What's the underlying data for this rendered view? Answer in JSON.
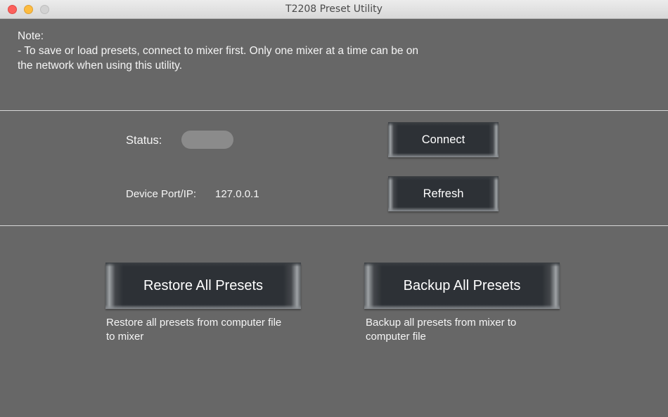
{
  "window": {
    "title": "T2208 Preset Utility"
  },
  "note": {
    "heading": "Note:",
    "line1": "- To save or load presets, connect to mixer first. Only one mixer at a time can be on",
    "line2": "the network when using this utility."
  },
  "connection": {
    "status_label": "Status:",
    "status_value": "",
    "port_label": "Device Port/IP:",
    "port_value": "127.0.0.1",
    "connect_label": "Connect",
    "refresh_label": "Refresh"
  },
  "actions": {
    "restore_label": "Restore All Presets",
    "restore_desc_line1": "Restore all presets from computer file",
    "restore_desc_line2": "to mixer",
    "backup_label": "Backup All Presets",
    "backup_desc_line1": "Backup all presets from mixer to",
    "backup_desc_line2": "computer file"
  }
}
